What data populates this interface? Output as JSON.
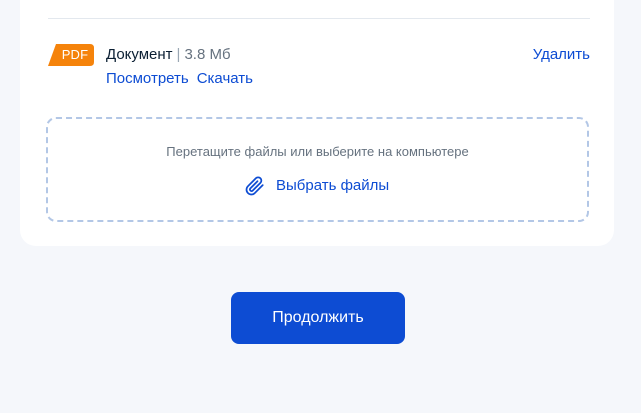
{
  "file": {
    "badge": "PDF",
    "name": "Документ",
    "separator": "|",
    "size": "3.8 Мб",
    "view_link": "Посмотреть",
    "download_link": "Скачать",
    "delete_link": "Удалить"
  },
  "dropzone": {
    "hint": "Перетащите файлы или выберите на компьютере",
    "choose_label": "Выбрать файлы",
    "icon": "paperclip-icon"
  },
  "actions": {
    "continue_label": "Продолжить"
  },
  "colors": {
    "page_background": "#f5f7fb",
    "card_background": "#ffffff",
    "accent": "#0d4cd3",
    "pdf_badge": "#f5830b",
    "dropzone_border": "#b3c7e6",
    "text_primary": "#0b1f33",
    "text_secondary": "#66727f"
  }
}
